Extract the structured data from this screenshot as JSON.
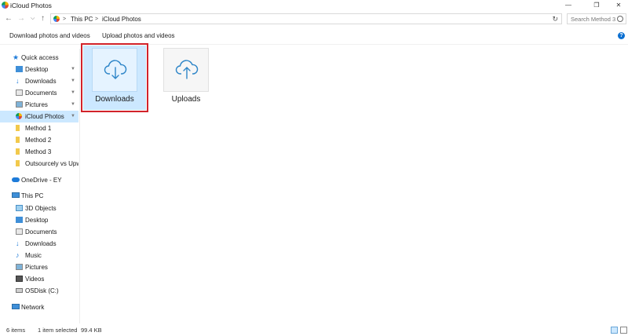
{
  "window": {
    "title": "iCloud Photos",
    "controls": {
      "minimize": "—",
      "maximize": "❐",
      "close": "✕"
    }
  },
  "address": {
    "crumbs": [
      "This PC",
      "iCloud Photos"
    ],
    "separator": ">",
    "search_placeholder": "Search Method 3"
  },
  "commands": {
    "download": "Download photos and videos",
    "upload": "Upload photos and videos",
    "help": "?"
  },
  "sidebar": {
    "items": [
      {
        "label": "Quick access",
        "icon": "star-icon"
      },
      {
        "label": "Desktop",
        "icon": "desktop-folder-icon"
      },
      {
        "label": "Downloads",
        "icon": "download-arrow-icon"
      },
      {
        "label": "Documents",
        "icon": "documents-icon"
      },
      {
        "label": "Pictures",
        "icon": "pictures-icon"
      },
      {
        "label": "iCloud Photos",
        "icon": "icloud-photos-icon"
      },
      {
        "label": "Method 1",
        "icon": "folder-icon"
      },
      {
        "label": "Method 2",
        "icon": "folder-icon"
      },
      {
        "label": "Method 3",
        "icon": "folder-icon"
      },
      {
        "label": "Outsourcely vs Upwork",
        "icon": "folder-icon"
      },
      {
        "label": "OneDrive - EY",
        "icon": "cloud-icon"
      },
      {
        "label": "This PC",
        "icon": "computer-icon"
      },
      {
        "label": "3D Objects",
        "icon": "cube-icon"
      },
      {
        "label": "Desktop",
        "icon": "desktop-folder-icon"
      },
      {
        "label": "Documents",
        "icon": "documents-icon"
      },
      {
        "label": "Downloads",
        "icon": "download-arrow-icon"
      },
      {
        "label": "Music",
        "icon": "music-note-icon"
      },
      {
        "label": "Pictures",
        "icon": "pictures-icon"
      },
      {
        "label": "Videos",
        "icon": "video-icon"
      },
      {
        "label": "OSDisk (C:)",
        "icon": "drive-icon"
      },
      {
        "label": "Network",
        "icon": "network-icon"
      }
    ],
    "pinned_marker": "📌"
  },
  "files": [
    {
      "label": "Downloads",
      "icon": "cloud-download-icon",
      "selected": true
    },
    {
      "label": "Uploads",
      "icon": "cloud-upload-icon",
      "selected": false
    }
  ],
  "status": {
    "items_count": "6 items",
    "selection": "1 item selected",
    "size": "99.4 KB"
  },
  "colors": {
    "accent": "#0b6fd1",
    "selection": "#cce8ff",
    "highlight_box": "#d2232a",
    "folder": "#f2c94c"
  }
}
